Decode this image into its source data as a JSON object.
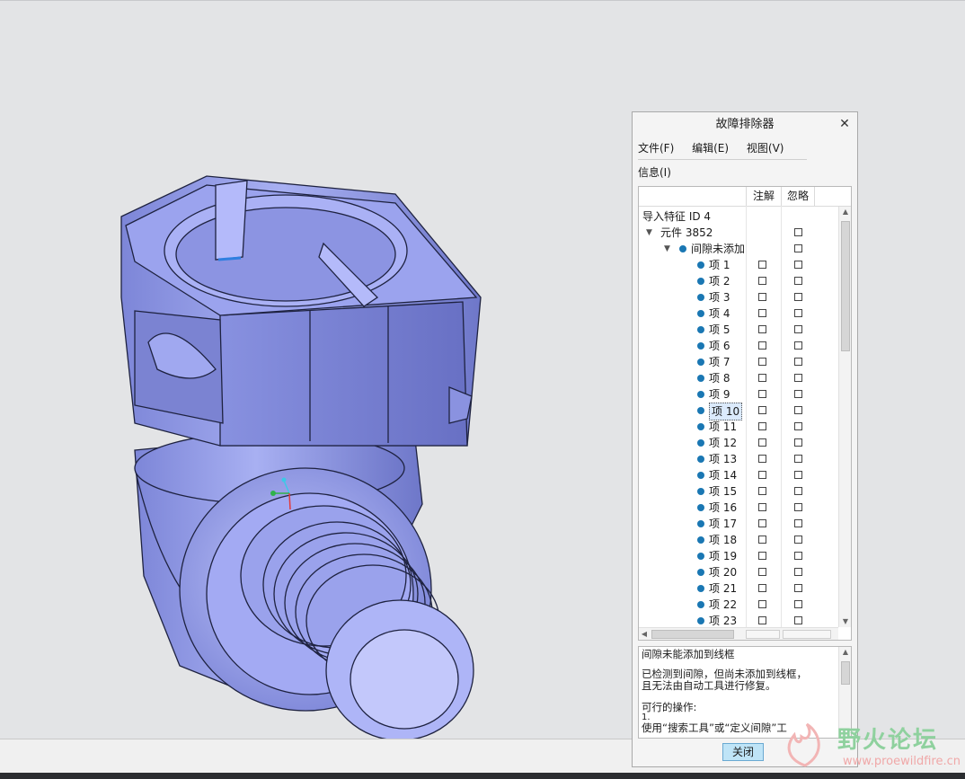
{
  "dialog": {
    "title": "故障排除器",
    "close_icon": "close-icon",
    "menu": {
      "file": "文件(F)",
      "edit": "编辑(E)",
      "view": "视图(V)",
      "info": "信息(I)"
    },
    "columns": {
      "annotate": "注解",
      "ignore": "忽略"
    },
    "tree": {
      "root": "导入特征 ID 4",
      "component": "元件 3852",
      "group": "间隙未添加",
      "items": [
        "项 1",
        "项 2",
        "项 3",
        "项 4",
        "项 5",
        "项 6",
        "项 7",
        "项 8",
        "项 9",
        "项 10",
        "项 11",
        "项 12",
        "项 13",
        "项 14",
        "项 15",
        "项 16",
        "项 17",
        "项 18",
        "项 19",
        "项 20",
        "项 21",
        "项 22",
        "项 23"
      ],
      "selected_item": "项 10"
    },
    "info": {
      "heading": "间隙未能添加到线框",
      "line1": "已检测到间隙，但尚未添加到线框，",
      "line2": "且无法由自动工具进行修复。",
      "actions_label": "可行的操作:",
      "action_number": "1.",
      "action_text": "使用“搜索工具”或“定义间隙”工"
    },
    "close_button": "关闭"
  },
  "watermark": {
    "main": "野火论坛",
    "sub": "www.proewildfire.cn"
  },
  "colors": {
    "model_fill": "#9aa2ea",
    "model_edge": "#1e2240",
    "accent_blue": "#1a77b3",
    "button_bg": "#bfe4f7"
  }
}
